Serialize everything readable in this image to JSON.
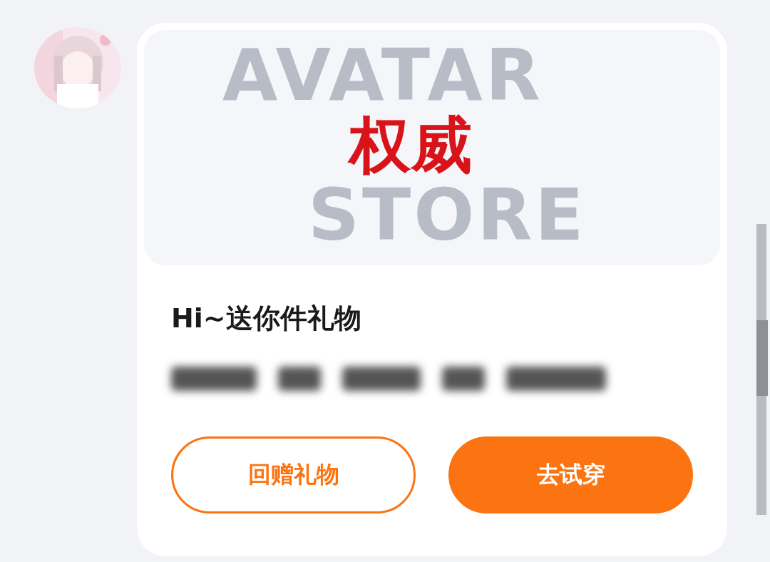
{
  "message": {
    "banner": {
      "background_words": [
        "AVATAR",
        "STORE"
      ],
      "headline": "权威"
    },
    "title": "Hi~送你件礼物",
    "buttons": [
      {
        "label": "回赠礼物",
        "kind": "outline"
      },
      {
        "label": "去试穿",
        "kind": "filled"
      }
    ]
  }
}
